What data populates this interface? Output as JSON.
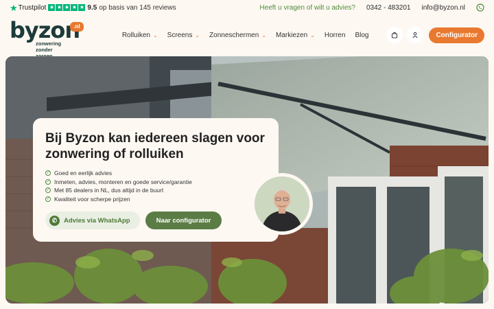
{
  "topbar": {
    "trustpilot_label": "Trustpilot",
    "rating": "9.5",
    "reviews_text": "op basis van 145 reviews",
    "help_text": "Heeft u vragen of wilt u advies?",
    "phone": "0342 - 483201",
    "email": "info@byzon.nl"
  },
  "logo": {
    "word": "byzon",
    "badge": ".nl",
    "tagline_line1": "zonwering",
    "tagline_line2": "zonder zorgen"
  },
  "nav": {
    "items": [
      {
        "label": "Rolluiken",
        "dropdown": true
      },
      {
        "label": "Screens",
        "dropdown": true
      },
      {
        "label": "Zonneschermen",
        "dropdown": true
      },
      {
        "label": "Markiezen",
        "dropdown": true
      },
      {
        "label": "Horren",
        "dropdown": false
      },
      {
        "label": "Blog",
        "dropdown": false
      }
    ],
    "configurator_label": "Configurator"
  },
  "hero": {
    "title": "Bij Byzon kan iedereen slagen voor zonwering of rolluiken",
    "usps": [
      "Goed en eerlijk advies",
      "Inmeten, advies, monteren en goede service/garantie",
      "Met 85 dealers in NL, dus altijd in de buurt",
      "Kwaliteit voor scherpe prijzen"
    ],
    "whatsapp_label": "Advies via WhatsApp",
    "configurator_label": "Naar configurator"
  },
  "colors": {
    "accent_orange": "#e8792f",
    "brand_green": "#5b7d45",
    "trustpilot_green": "#00b67a",
    "logo_dark": "#1d3b3a",
    "background": "#fdf8f2"
  },
  "icons": [
    "trustpilot-star-icon",
    "whatsapp-icon",
    "chevron-down-icon",
    "shopping-bag-icon",
    "user-icon",
    "check-circle-icon"
  ]
}
